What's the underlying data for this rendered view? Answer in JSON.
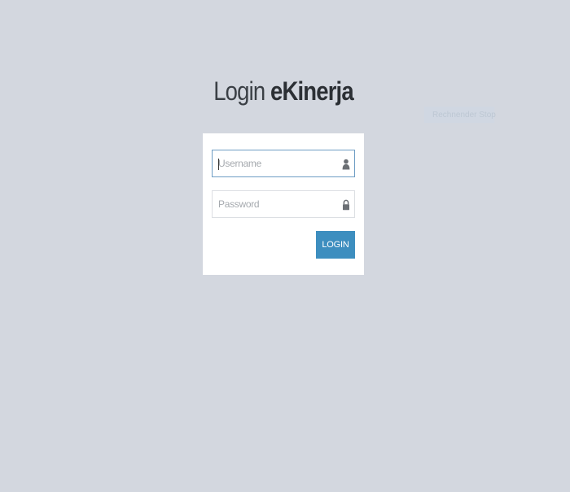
{
  "header": {
    "title_light": "Login",
    "title_bold": "eKinerja"
  },
  "badge": {
    "label": "Rechnender Stop"
  },
  "form": {
    "username": {
      "placeholder": "Username",
      "value": "",
      "icon": "user-icon",
      "focused": true
    },
    "password": {
      "placeholder": "Password",
      "value": "",
      "icon": "lock-icon"
    },
    "login_label": "LOGIN"
  },
  "colors": {
    "background": "#d3d7df",
    "card": "#ffffff",
    "accent": "#3d8ebf",
    "focus_border": "#6e9dc4"
  }
}
